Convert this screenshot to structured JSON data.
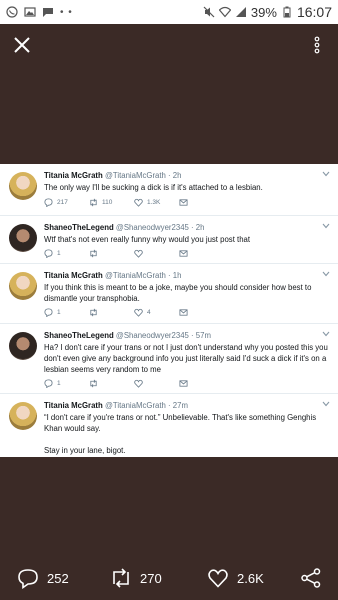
{
  "status_bar": {
    "battery_percent": "39%",
    "time": "16:07",
    "more_dots": "• •"
  },
  "tweets": [
    {
      "name": "Titania McGrath",
      "handle": "@TitaniaMcGrath",
      "time": "· 2h",
      "text": "The only way I'll be sucking a dick is if it's attached to a lesbian.",
      "reply_count": "217",
      "retweet_count": "110",
      "like_count": "1.3K"
    },
    {
      "name": "ShaneoTheLegend",
      "handle": "@Shaneodwyer2345",
      "time": "· 2h",
      "text": "Wtf that's not even really funny why would you just post that",
      "reply_count": "1",
      "retweet_count": "",
      "like_count": ""
    },
    {
      "name": "Titania McGrath",
      "handle": "@TitaniaMcGrath",
      "time": "· 1h",
      "text": "If you think this is meant to be a joke, maybe you should consider how best to dismantle your transphobia.",
      "reply_count": "1",
      "retweet_count": "",
      "like_count": "4"
    },
    {
      "name": "ShaneoTheLegend",
      "handle": "@Shaneodwyer2345",
      "time": "· 57m",
      "text": "Ha? I don't care if your trans or not I just don't understand why you posted this you don't even give any background info you just literally said I'd suck a dick if it's on a lesbian seems very random to me",
      "reply_count": "1",
      "retweet_count": "",
      "like_count": ""
    },
    {
      "name": "Titania McGrath",
      "handle": "@TitaniaMcGrath",
      "time": "· 27m",
      "text": "“I don't care if you're trans or not.” Unbelievable. That's like something Genghis Khan would say.",
      "text2": "Stay in your lane, bigot."
    }
  ],
  "bottom_bar": {
    "reply_count": "252",
    "retweet_count": "270",
    "like_count": "2.6K"
  }
}
